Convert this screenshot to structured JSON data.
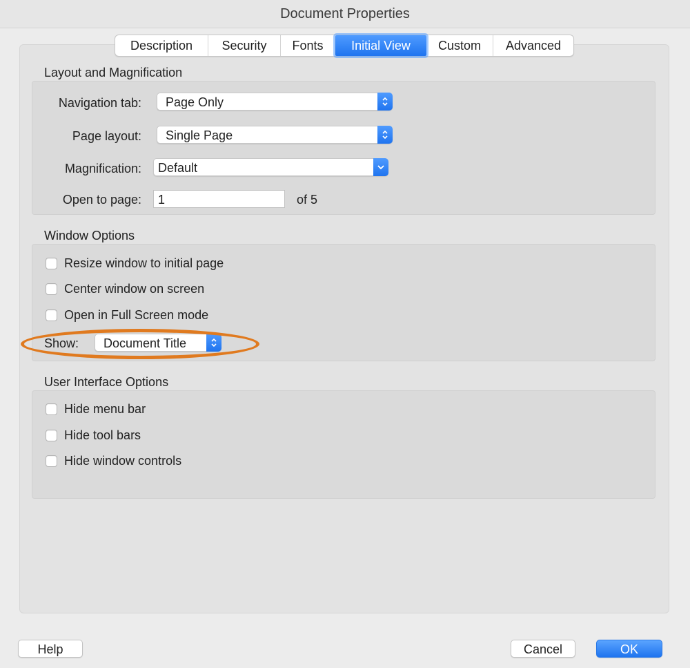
{
  "window": {
    "title": "Document Properties"
  },
  "tabs": [
    {
      "label": "Description"
    },
    {
      "label": "Security"
    },
    {
      "label": "Fonts"
    },
    {
      "label": "Initial View"
    },
    {
      "label": "Custom"
    },
    {
      "label": "Advanced"
    }
  ],
  "active_tab": "Initial View",
  "layout_magnification": {
    "title": "Layout and Magnification",
    "navigation_tab": {
      "label": "Navigation tab:",
      "value": "Page Only"
    },
    "page_layout": {
      "label": "Page layout:",
      "value": "Single Page"
    },
    "magnification": {
      "label": "Magnification:",
      "value": "Default"
    },
    "open_to_page": {
      "label": "Open to page:",
      "value": "1",
      "suffix": "of 5"
    }
  },
  "window_options": {
    "title": "Window Options",
    "checkboxes": [
      {
        "label": "Resize window to initial page",
        "checked": false
      },
      {
        "label": "Center window on screen",
        "checked": false
      },
      {
        "label": "Open in Full Screen mode",
        "checked": false
      }
    ],
    "show": {
      "label": "Show:",
      "value": "Document Title"
    }
  },
  "ui_options": {
    "title": "User Interface Options",
    "checkboxes": [
      {
        "label": "Hide menu bar",
        "checked": false
      },
      {
        "label": "Hide tool bars",
        "checked": false
      },
      {
        "label": "Hide window controls",
        "checked": false
      }
    ]
  },
  "buttons": {
    "help": "Help",
    "cancel": "Cancel",
    "ok": "OK"
  },
  "colors": {
    "accent": "#1f74ef",
    "highlight_ellipse": "#e07a1f",
    "panel": "#e3e3e3"
  },
  "icons": {
    "stepper": "up-down-chevron-icon",
    "dropdown": "chevron-down-icon"
  }
}
